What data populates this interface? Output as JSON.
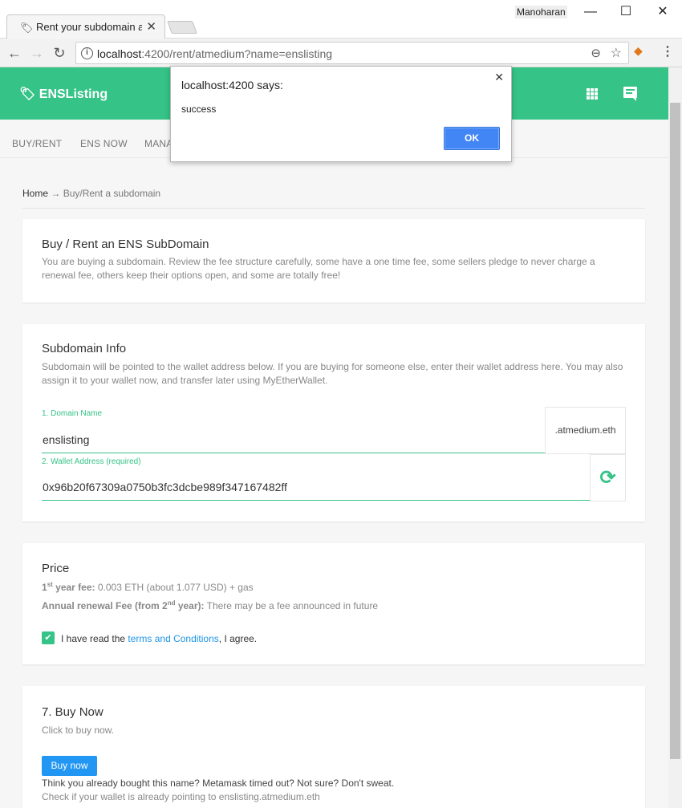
{
  "browser": {
    "tab_title": "Rent your subdomain at",
    "user_name": "Manoharan",
    "url_host": "localhost",
    "url_rest": ":4200/rent/atmedium?name=enslisting"
  },
  "dialog": {
    "title": "localhost:4200 says:",
    "message": "success",
    "ok_label": "OK"
  },
  "header": {
    "brand": "ENSListing"
  },
  "subnav": {
    "items": [
      "BUY/RENT",
      "ENS NOW",
      "MANA"
    ]
  },
  "breadcrumb": {
    "home": "Home",
    "arrow": "→",
    "current": "Buy/Rent a subdomain"
  },
  "intro": {
    "title": "Buy / Rent an ENS SubDomain",
    "description": "You are buying a subdomain. Review the fee structure carefully, some have a one time fee, some sellers pledge to never charge a renewal fee, others keep their options open, and some are totally free!"
  },
  "subdomain_info": {
    "title": "Subdomain Info",
    "description": "Subdomain will be pointed to the wallet address below. If you are buying for someone else, enter their wallet address here. You may also assign it to your wallet now, and transfer later using MyEtherWallet.",
    "domain_label": "1. Domain Name",
    "domain_value": "enslisting",
    "domain_suffix": ".atmedium.eth",
    "wallet_label": "2. Wallet Address (required)",
    "wallet_value": "0x96b20f67309a0750b3fc3dcbe989f347167482ff"
  },
  "price": {
    "title": "Price",
    "first_year_prefix": "1",
    "first_year_sup": "st",
    "first_year_label": " year fee:",
    "first_year_value": " 0.003 ETH (about 1.077 USD) + gas",
    "renewal_label_a": "Annual renewal Fee (from 2",
    "renewal_sup": "nd",
    "renewal_label_b": " year):",
    "renewal_value": " There may be a fee announced in future",
    "agree_prefix": "I have read the ",
    "agree_link": "terms and Conditions",
    "agree_suffix": ", I agree."
  },
  "buy": {
    "title": "7. Buy Now",
    "subtitle": "Click to buy now.",
    "button_label": "Buy now",
    "note": "Think you already bought this name? Metamask timed out? Not sure? Don't sweat.",
    "check_link": "Check if your wallet is already pointing to enslisting.atmedium.eth"
  },
  "colors": {
    "brand_green": "#35c387",
    "button_blue": "#2196f3",
    "dialog_ok_blue": "#4285f4"
  }
}
